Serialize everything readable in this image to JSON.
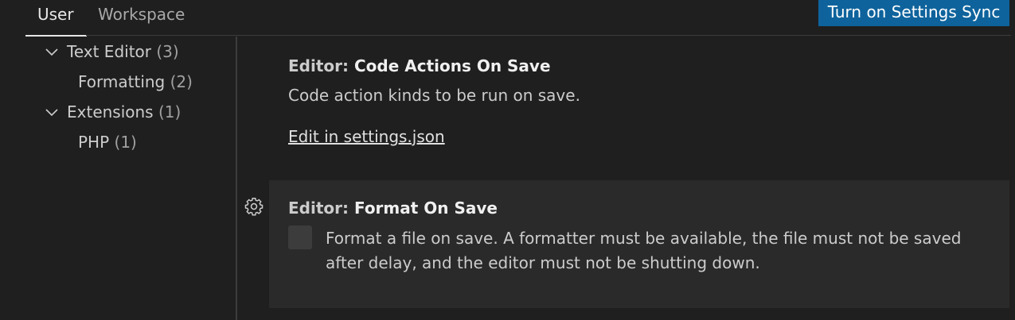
{
  "tabs": [
    {
      "label": "User"
    },
    {
      "label": "Workspace"
    }
  ],
  "sync_button": {
    "label": "Turn on Settings Sync"
  },
  "toc": {
    "items": [
      {
        "label": "Text Editor",
        "count": "(3)",
        "expanded": true
      },
      {
        "label": "Formatting",
        "count": "(2)"
      },
      {
        "label": "Extensions",
        "count": "(1)",
        "expanded": true
      },
      {
        "label": "PHP",
        "count": "(1)"
      }
    ]
  },
  "settings": [
    {
      "category": "Editor: ",
      "name": "Code Actions On Save",
      "description": "Code action kinds to be run on save.",
      "link": "Edit in settings.json"
    },
    {
      "category": "Editor: ",
      "name": "Format On Save",
      "description": "Format a file on save. A formatter must be available, the file must not be saved after delay, and the editor must not be shutting down.",
      "checked": false
    }
  ],
  "icons": {
    "chevron": "chevron-down-icon",
    "gear": "gear-icon"
  },
  "colors": {
    "background": "#1f1f1f",
    "panel": "#2a2a2a",
    "sync_button": "#0e639c",
    "checkbox": "#3c3c3c"
  }
}
